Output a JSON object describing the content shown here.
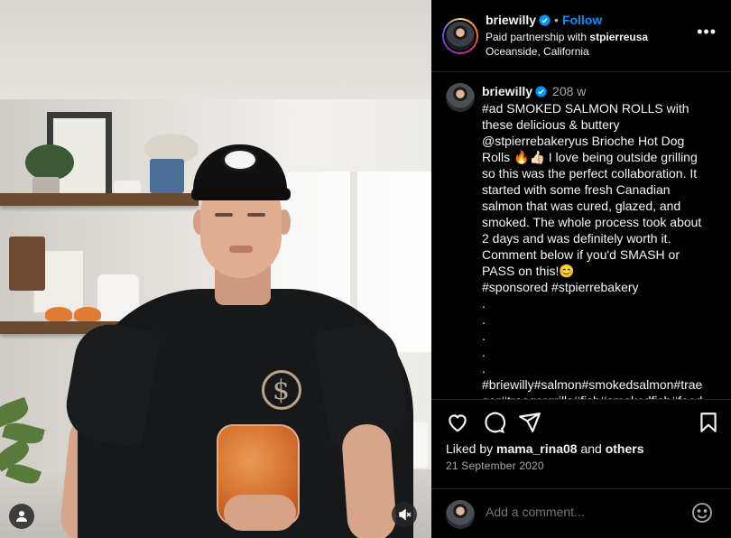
{
  "post": {
    "username": "briewilly",
    "follow_label": "Follow",
    "separator": "•",
    "partnership_prefix": "Paid partnership with",
    "partner": "stpierreusa",
    "location": "Oceanside, California",
    "more_label": "•••"
  },
  "caption": {
    "username": "briewilly",
    "age": "208 w",
    "lines": [
      "#ad SMOKED SALMON ROLLS with",
      "these delicious & buttery",
      "@stpierrebakeryus Brioche Hot Dog",
      "Rolls 🔥👍🏻 I love being outside grilling",
      "so this was the perfect collaboration. It",
      "started with some fresh Canadian",
      "salmon that was cured, glazed, and",
      "smoked. The whole process took about",
      "2 days and was definitely worth it.",
      "Comment below if you'd SMASH or",
      "PASS on this!😊",
      "#sponsored #stpierrebakery",
      ".",
      ".",
      ".",
      ".",
      ".",
      "#briewilly#salmon#smokedsalmon#trae",
      "ger#traegergrills#fish#smokedfish#food"
    ]
  },
  "actions": {
    "liked_prefix": "Liked by",
    "liked_user": "mama_rina08",
    "liked_and": "and",
    "liked_others": "others",
    "date": "21 September 2020"
  },
  "comment": {
    "placeholder": "Add a comment..."
  },
  "colors": {
    "accent": "#0095f6",
    "background": "#000000",
    "muted": "#a8a8a8",
    "divider": "#262626"
  },
  "icons": {
    "header": [
      "verified-badge-icon",
      "more-options-icon"
    ],
    "media": [
      "user-tag-icon",
      "mute-icon"
    ],
    "actions": [
      "heart-icon",
      "comment-icon",
      "share-icon",
      "bookmark-icon",
      "emoji-icon"
    ]
  }
}
